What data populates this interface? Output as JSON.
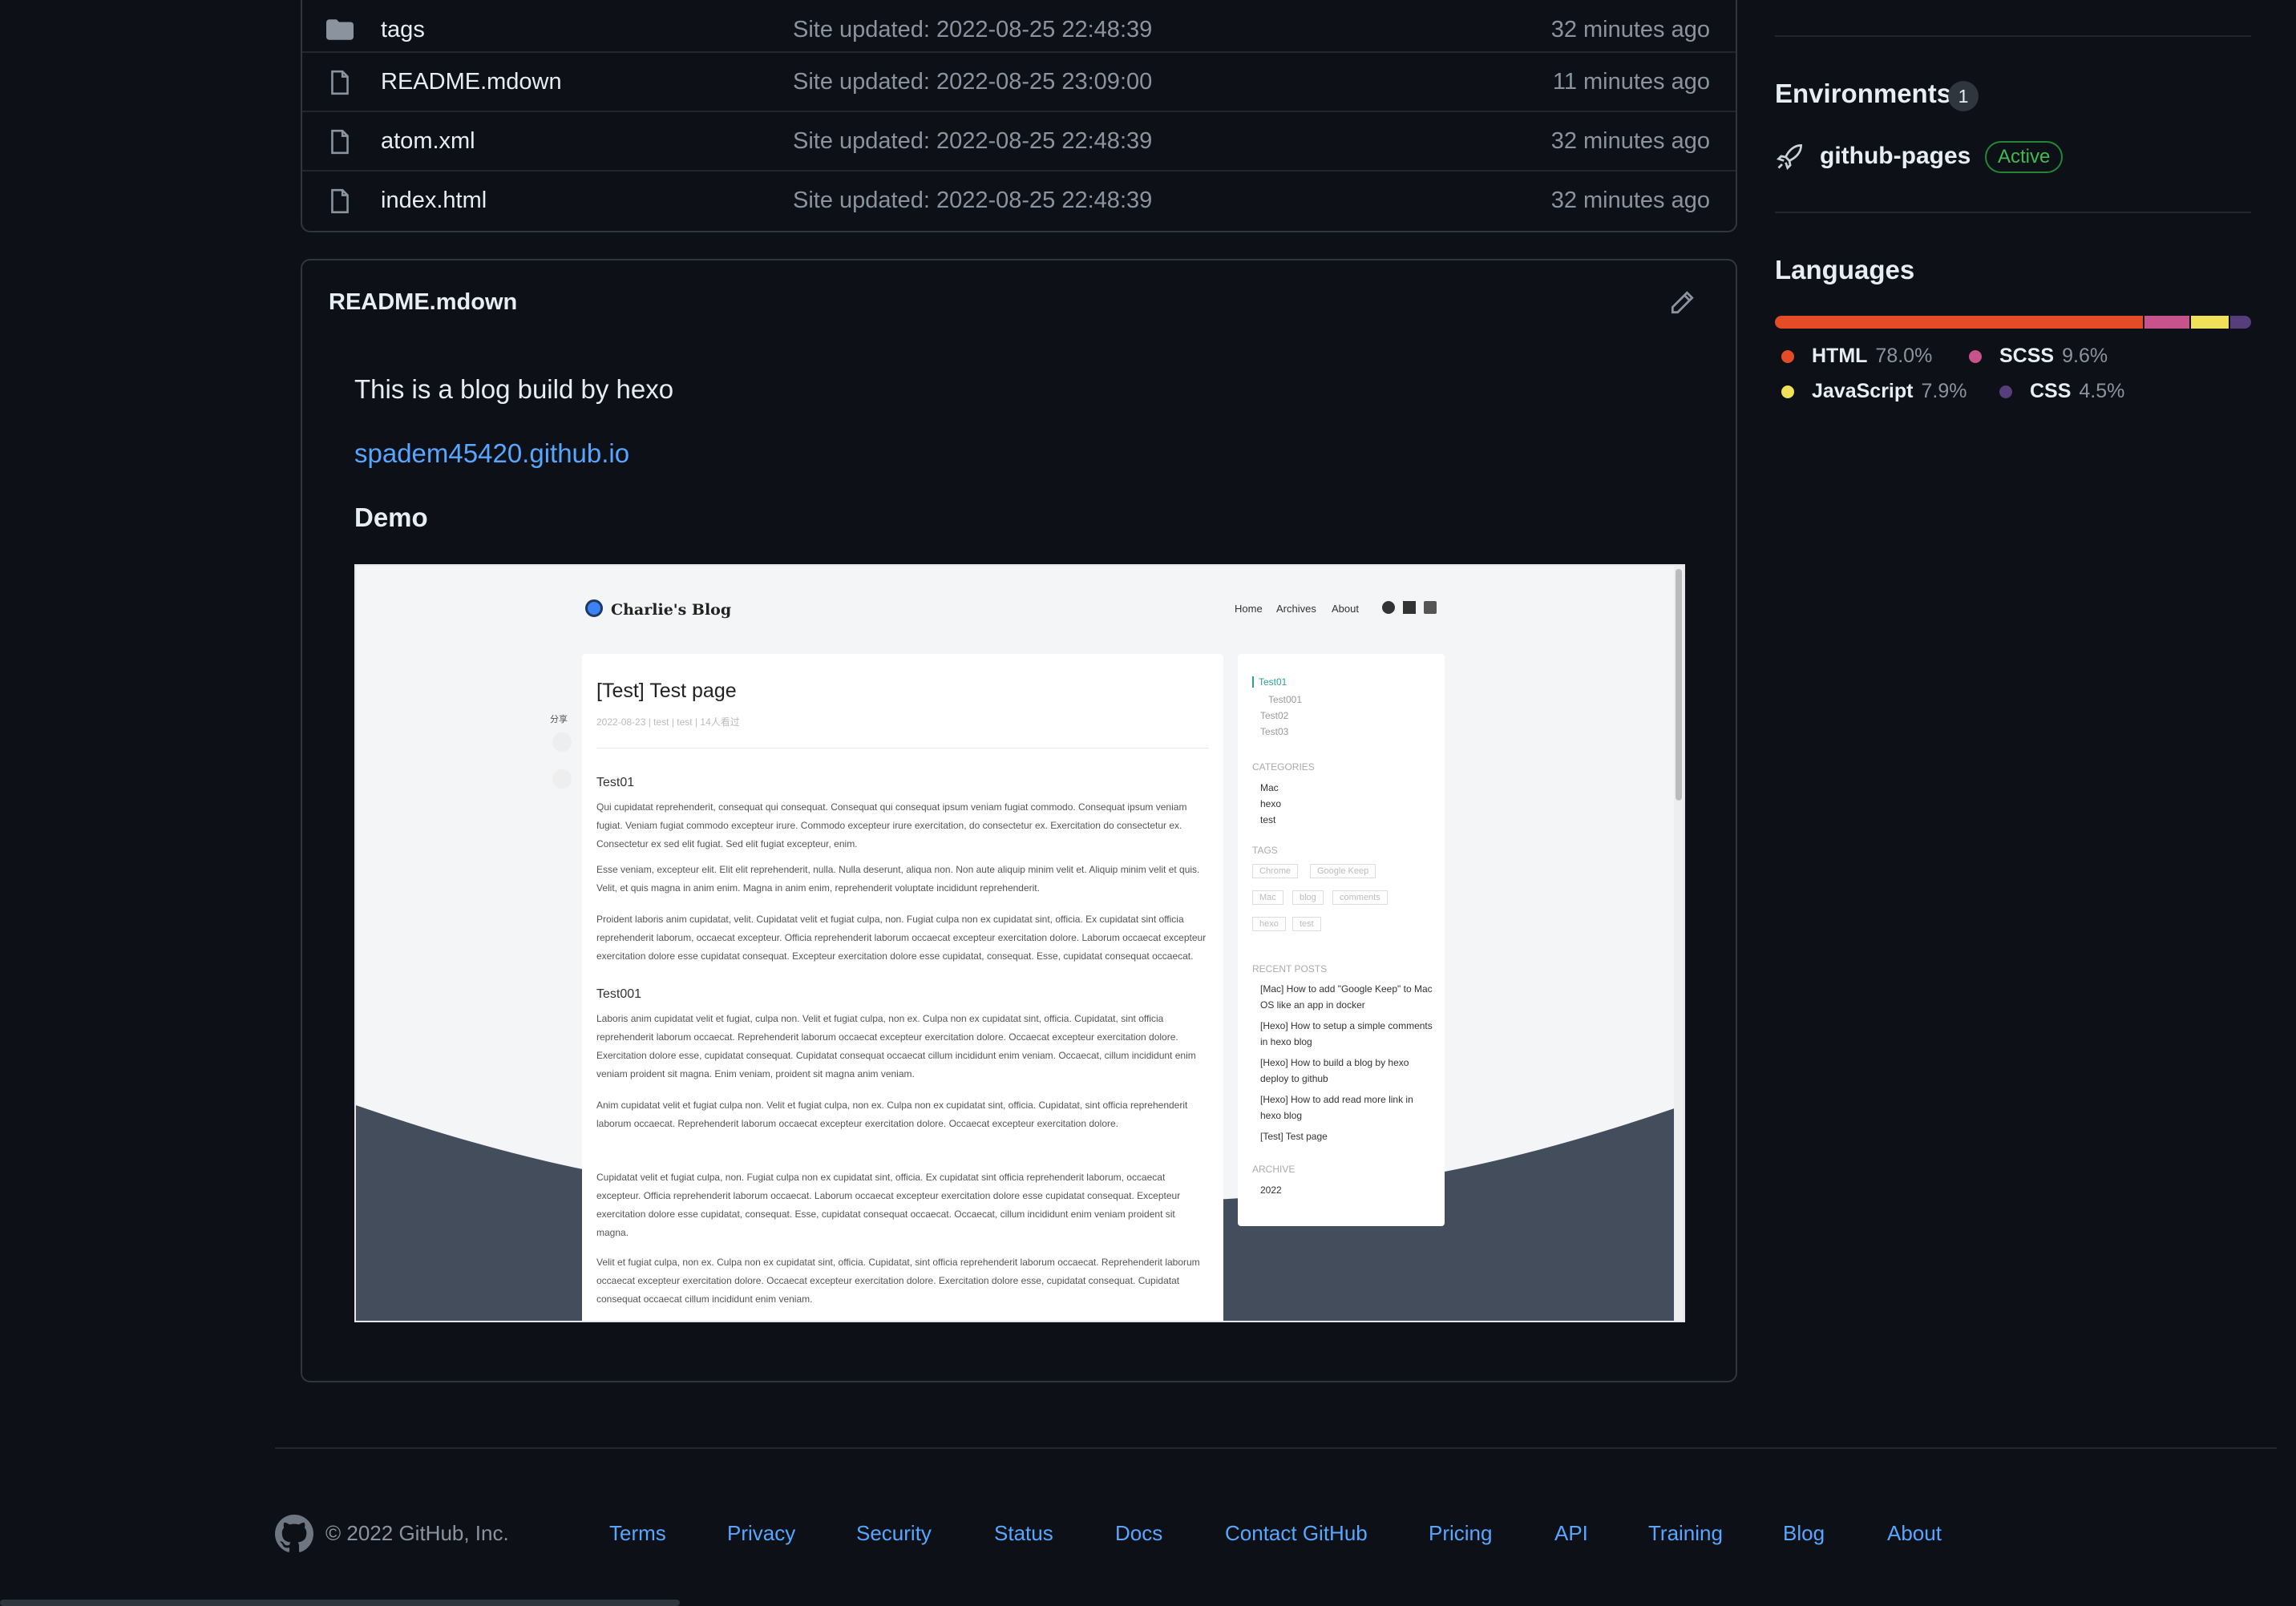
{
  "files": [
    {
      "name": "tags",
      "type": "folder",
      "message": "Site updated: 2022-08-25 22:48:39",
      "age": "32 minutes ago"
    },
    {
      "name": "README.mdown",
      "type": "file",
      "message": "Site updated: 2022-08-25 23:09:00",
      "age": "11 minutes ago"
    },
    {
      "name": "atom.xml",
      "type": "file",
      "message": "Site updated: 2022-08-25 22:48:39",
      "age": "32 minutes ago"
    },
    {
      "name": "index.html",
      "type": "file",
      "message": "Site updated: 2022-08-25 22:48:39",
      "age": "32 minutes ago"
    }
  ],
  "readme": {
    "title": "README.mdown",
    "text": "This is a blog build by hexo",
    "link": "spadem45420.github.io",
    "heading": "Demo"
  },
  "demo": {
    "brand": "Charlie's Blog",
    "nav": [
      "Home",
      "Archives",
      "About"
    ],
    "share": "分享",
    "post_title": "[Test] Test page",
    "post_meta": "2022-08-23 | test | test | 14人看过",
    "h1": "Test01",
    "h2": "Test001",
    "paragraphs": [
      "Qui cupidatat reprehenderit, consequat qui consequat. Consequat qui consequat ipsum veniam fugiat commodo. Consequat ipsum veniam fugiat. Veniam fugiat commodo excepteur irure. Commodo excepteur irure exercitation, do consectetur ex. Exercitation do consectetur ex. Consectetur ex sed elit fugiat. Sed elit fugiat excepteur, enim.",
      "Esse veniam, excepteur elit. Elit elit reprehenderit, nulla. Nulla deserunt, aliqua non. Non aute aliquip minim velit et. Aliquip minim velit et quis. Velit, et quis magna in anim enim. Magna in anim enim, reprehenderit voluptate incididunt reprehenderit.",
      "Proident laboris anim cupidatat, velit. Cupidatat velit et fugiat culpa, non. Fugiat culpa non ex cupidatat sint, officia. Ex cupidatat sint officia reprehenderit laborum, occaecat excepteur. Officia reprehenderit laborum occaecat excepteur exercitation dolore. Laborum occaecat excepteur exercitation dolore esse cupidatat consequat. Excepteur exercitation dolore esse cupidatat, consequat. Esse, cupidatat consequat occaecat.",
      "Laboris anim cupidatat velit et fugiat, culpa non. Velit et fugiat culpa, non ex. Culpa non ex cupidatat sint, officia. Cupidatat, sint officia reprehenderit laborum occaecat. Reprehenderit laborum occaecat excepteur exercitation dolore. Occaecat excepteur exercitation dolore. Exercitation dolore esse, cupidatat consequat. Cupidatat consequat occaecat cillum incididunt enim veniam. Occaecat, cillum incididunt enim veniam proident sit magna. Enim veniam, proident sit magna anim veniam.",
      "Anim cupidatat velit et fugiat culpa non. Velit et fugiat culpa, non ex. Culpa non ex cupidatat sint, officia. Cupidatat, sint officia reprehenderit laborum occaecat. Reprehenderit laborum occaecat excepteur exercitation dolore. Occaecat excepteur exercitation dolore.",
      "Cupidatat velit et fugiat culpa, non. Fugiat culpa non ex cupidatat sint, officia. Ex cupidatat sint officia reprehenderit laborum, occaecat excepteur. Officia reprehenderit laborum occaecat. Laborum occaecat excepteur exercitation dolore esse cupidatat consequat. Excepteur exercitation dolore esse cupidatat, consequat. Esse, cupidatat consequat occaecat. Occaecat, cillum incididunt enim veniam proident sit magna.",
      "Velit et fugiat culpa, non ex. Culpa non ex cupidatat sint, officia. Cupidatat, sint officia reprehenderit laborum occaecat. Reprehenderit laborum occaecat excepteur exercitation dolore. Occaecat excepteur exercitation dolore. Exercitation dolore esse, cupidatat consequat. Cupidatat consequat occaecat cillum incididunt enim veniam."
    ],
    "toc": [
      "Test01",
      "Test001",
      "Test02",
      "Test03"
    ],
    "categories_title": "CATEGORIES",
    "categories": [
      "Mac",
      "hexo",
      "test"
    ],
    "tags_title": "TAGS",
    "tags": [
      "Chrome",
      "Google Keep",
      "Mac",
      "blog",
      "comments",
      "hexo",
      "test"
    ],
    "recent_title": "RECENT POSTS",
    "recent": [
      "[Mac] How to add \"Google Keep\" to Mac OS like an app in docker",
      "[Hexo] How to setup a simple comments in hexo blog",
      "[Hexo] How to build a blog by hexo deploy to github",
      "[Hexo] How to add read more link in hexo blog",
      "[Test] Test page"
    ],
    "archive_title": "ARCHIVE",
    "archive": [
      "2022"
    ]
  },
  "environments": {
    "title": "Environments",
    "count": "1",
    "name": "github-pages",
    "status": "Active"
  },
  "languages": {
    "title": "Languages",
    "items": [
      {
        "name": "HTML",
        "percent": "78.0%",
        "value": 78.0,
        "color": "#e34c26"
      },
      {
        "name": "SCSS",
        "percent": "9.6%",
        "value": 9.6,
        "color": "#c6538c"
      },
      {
        "name": "JavaScript",
        "percent": "7.9%",
        "value": 7.9,
        "color": "#f1e05a"
      },
      {
        "name": "CSS",
        "percent": "4.5%",
        "value": 4.5,
        "color": "#563d7c"
      }
    ]
  },
  "footer": {
    "copyright": "© 2022 GitHub, Inc.",
    "links": [
      "Terms",
      "Privacy",
      "Security",
      "Status",
      "Docs",
      "Contact GitHub",
      "Pricing",
      "API",
      "Training",
      "Blog",
      "About"
    ]
  }
}
